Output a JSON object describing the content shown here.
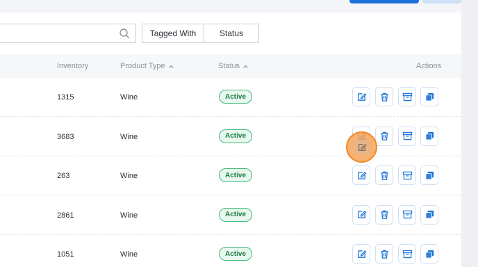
{
  "filters": {
    "tagged_with": "Tagged With",
    "status": "Status"
  },
  "columns": {
    "inventory": "Inventory",
    "product_type": "Product Type",
    "status": "Status",
    "actions": "Actions"
  },
  "rows": [
    {
      "inventory": "1315",
      "product_type": "Wine",
      "status": "Active"
    },
    {
      "inventory": "3683",
      "product_type": "Wine",
      "status": "Active"
    },
    {
      "inventory": "263",
      "product_type": "Wine",
      "status": "Active"
    },
    {
      "inventory": "2861",
      "product_type": "Wine",
      "status": "Active"
    },
    {
      "inventory": "1051",
      "product_type": "Wine",
      "status": "Active"
    }
  ],
  "icons": {
    "search": "search-icon",
    "sort": "chevron-up-icon",
    "edit": "edit-icon",
    "delete": "trash-icon",
    "archive": "archive-icon",
    "duplicate": "duplicate-icon"
  },
  "colors": {
    "accent": "#1a73d9",
    "active_badge": "#3fb97a",
    "highlight": "#f6a358"
  }
}
